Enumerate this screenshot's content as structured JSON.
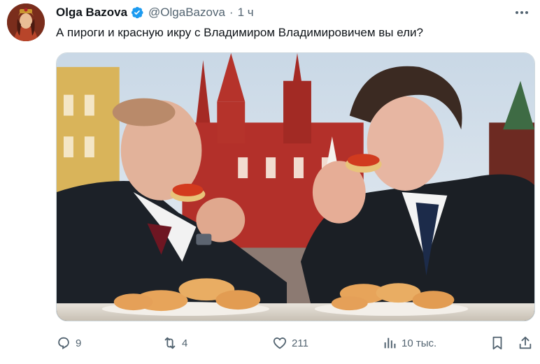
{
  "author": {
    "name": "Olga Bazova",
    "handle": "@OlgaBazova",
    "separator": "·",
    "time": "1 ч"
  },
  "post": {
    "text": "А пироги и красную икру с Владимиром Владимировичем вы ели?"
  },
  "media": {
    "type": "photo"
  },
  "actions": {
    "replies": "9",
    "reposts": "4",
    "likes": "211",
    "views": "10 тыс."
  },
  "icons": {
    "verified": "verified-badge-icon",
    "more": "more-icon",
    "reply": "reply-icon",
    "repost": "repost-icon",
    "like": "heart-icon",
    "views": "views-icon",
    "bookmark": "bookmark-icon",
    "share": "share-icon"
  },
  "colors": {
    "accent": "#1d9bf0",
    "text": "#0f1419",
    "muted": "#536471"
  }
}
